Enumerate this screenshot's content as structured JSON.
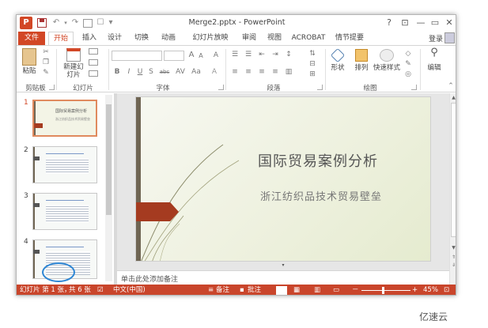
{
  "window": {
    "title": "Merge2.pptx - PowerPoint",
    "app_logo": "P",
    "help": "?",
    "ribbon_display": "⊡",
    "minimize": "—",
    "restore": "▭",
    "close": "✕"
  },
  "quick_access": {
    "undo": "↶",
    "redo": "↷",
    "customize": "▾"
  },
  "tabs": [
    "文件",
    "开始",
    "插入",
    "设计",
    "切换",
    "动画",
    "幻灯片放映",
    "审阅",
    "视图",
    "ACROBAT",
    "情节提要"
  ],
  "account": {
    "login": "登录"
  },
  "ribbon": {
    "clipboard": {
      "paste": "粘贴",
      "group": "剪贴板"
    },
    "slides": {
      "new_slide": "新建幻灯片",
      "group": "幻灯片"
    },
    "font": {
      "group": "字体",
      "bold": "B",
      "italic": "I",
      "underline": "U",
      "strike": "S",
      "shadow": "abc",
      "grow": "A",
      "shrink": "A",
      "clear": "A"
    },
    "paragraph": {
      "group": "段落"
    },
    "drawing": {
      "shapes": "形状",
      "arrange": "排列",
      "quick_styles": "快速样式",
      "group": "绘图"
    },
    "editing": {
      "label": "编辑"
    }
  },
  "thumbnails": [
    {
      "num": "1",
      "title": "国际贸易案例分析",
      "sub": "浙江纺织品技术贸易壁垒"
    },
    {
      "num": "2"
    },
    {
      "num": "3"
    },
    {
      "num": "4"
    }
  ],
  "slide": {
    "title": "国际贸易案例分析",
    "subtitle": "浙江纺织品技术贸易壁垒"
  },
  "notes": {
    "placeholder": "单击此处添加备注"
  },
  "status": {
    "slide_indicator": "幻灯片 第 1 张，",
    "total": "共 6 张",
    "language": "中文(中国)",
    "notes_btn": "备注",
    "comments_btn": "批注",
    "zoom": "45%",
    "zoom_minus": "－",
    "zoom_plus": "+"
  },
  "colors": {
    "accent": "#d24726",
    "statusbar": "#c9452b",
    "highlight_circle": "#2c85d4"
  },
  "watermark": "亿速云"
}
